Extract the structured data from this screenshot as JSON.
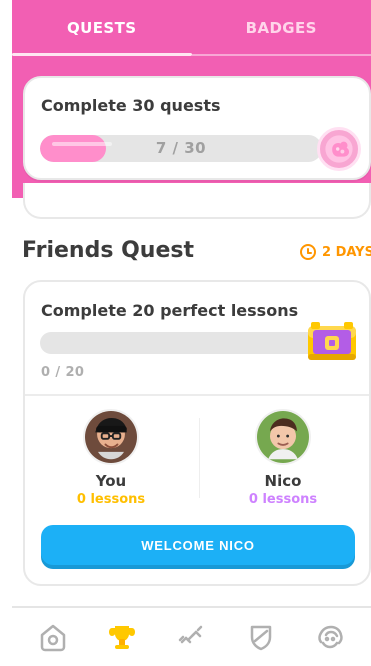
{
  "colors": {
    "header_pink": "#f25fb3",
    "progress_pink": "#ff8ecb",
    "badge_orange": "#ff9600",
    "button_blue": "#1cb0f6",
    "you_gold": "#ffbf00",
    "nico_purple": "#ce82ff"
  },
  "tabs": [
    {
      "label": "QUESTS"
    },
    {
      "label": "BADGES"
    }
  ],
  "quest_card": {
    "title": "Complete 30 quests",
    "progress_text": "7 / 30",
    "progress_fraction": 0.2333
  },
  "friends_quest": {
    "heading": "Friends Quest",
    "days": "2 DAYS",
    "card_title": "Complete 20 perfect lessons",
    "count": "0 / 20",
    "participants": [
      {
        "name": "You",
        "lessons": "0 lessons"
      },
      {
        "name": "Nico",
        "lessons": "0 lessons"
      }
    ],
    "button_label": "WELCOME NICO"
  },
  "bottom_nav": [
    {
      "icon": "home-icon"
    },
    {
      "icon": "trophy-icon"
    },
    {
      "icon": "dumbbell-icon"
    },
    {
      "icon": "shield-icon"
    },
    {
      "icon": "profile-icon"
    }
  ]
}
